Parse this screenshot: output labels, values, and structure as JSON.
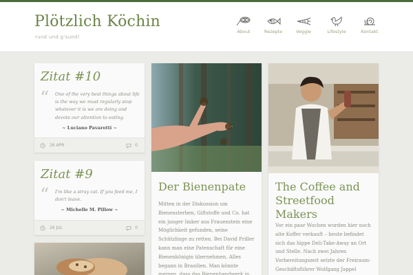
{
  "site": {
    "title": "Plötzlich Köchin",
    "tagline": "rund und g'sund!"
  },
  "colors": {
    "accent": "#7b9353",
    "topbar": "#4a6d3a",
    "background": "#ebebe8"
  },
  "nav": [
    {
      "label": "About",
      "icon": "whisk-icon"
    },
    {
      "label": "Rezepte",
      "icon": "fish-icon"
    },
    {
      "label": "Veggie",
      "icon": "vegetable-icon"
    },
    {
      "label": "Lifestyle",
      "icon": "rooster-icon"
    },
    {
      "label": "Kontakt",
      "icon": "snail-icon"
    }
  ],
  "quotes": [
    {
      "title": "Zitat #10",
      "text": "One of the very best things about life is the way we must regularly stop whatever it is we are doing and devote our attention to eating.",
      "author": "~ Luciano Pavarotti ~",
      "date": "26 APR",
      "comments": "0"
    },
    {
      "title": "Zitat #9",
      "text": "I'm like a stray cat. If you feed me, I don't leave.",
      "author": "~ Michelle M. Pillow ~",
      "date": "26 JUL",
      "comments": "0"
    }
  ],
  "posts": [
    {
      "title": "Der Bienenpate",
      "excerpt": "Mitten in der Diskussion um Bienensterben, Giftstoffe und Co. hat ein junger Imker aus Frauenstein eine Möglichkeit gefunden, seine Schützlinge zu retten. Bei David Priller kann man eine Patenschaft für eine Bienenkönigin übernehmen. Alles begann in Brasilien. Man könnte meinen, dass das Bienenhandwerk in Davids Familie liegt."
    },
    {
      "title": "The Coffee and Streetfood Makers",
      "excerpt": "Vor ein paar Wochen wurden hier noch alte Koffer verkauft – heute befindet sich das hippe Deli-Take-Away an Ort und Stelle. Nach zwei Jahren Vorbereitungszeit setzte der Freiraum-Geschäftsführer Wolfgang Jappel"
    }
  ]
}
